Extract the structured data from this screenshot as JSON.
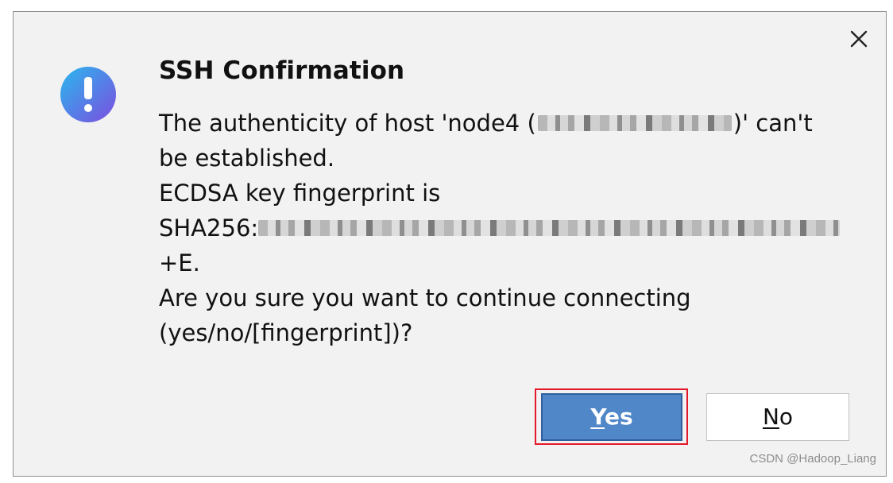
{
  "dialog": {
    "title": "SSH Confirmation",
    "message": {
      "line1_prefix": "The authenticity of host 'node4 (",
      "line1_suffix": ")' can't",
      "line2": "be established.",
      "line3": "ECDSA key fingerprint is",
      "line4_prefix": "SHA256:",
      "line5": "+E.",
      "line6": "Are you sure you want to continue connecting",
      "line7": "(yes/no/[fingerprint])?"
    },
    "buttons": {
      "yes": {
        "mnemonic": "Y",
        "rest": "es",
        "highlight_color": "#e3182a"
      },
      "no": {
        "mnemonic": "N",
        "rest": "o"
      }
    },
    "icons": {
      "info": "info-icon",
      "close": "close-icon"
    },
    "colors": {
      "background": "#f2f2f2",
      "accent": "#4f87c8",
      "info_gradient_start": "#2ab8ee",
      "info_gradient_end": "#7c4de0"
    }
  },
  "watermark": "CSDN @Hadoop_Liang"
}
